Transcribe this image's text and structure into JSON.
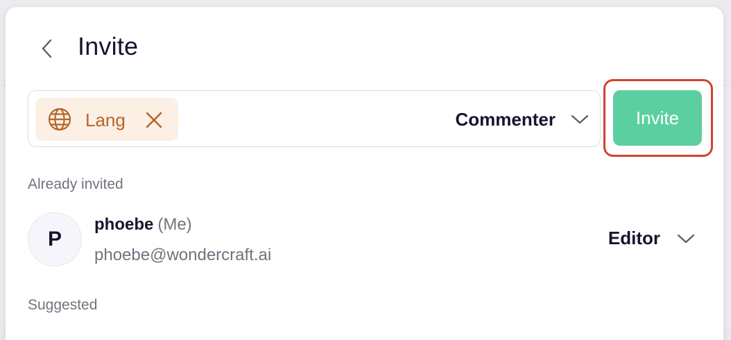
{
  "header": {
    "title": "Invite",
    "back_icon": "chevron-left-icon"
  },
  "invite": {
    "chip": {
      "label": "Lang",
      "icon": "globe-icon",
      "remove_icon": "close-icon"
    },
    "role": {
      "selected": "Commenter",
      "icon": "chevron-down-icon"
    },
    "button_label": "Invite"
  },
  "already_invited": {
    "heading": "Already invited",
    "members": [
      {
        "initial": "P",
        "name": "phoebe",
        "tag": "(Me)",
        "email": "phoebe@wondercraft.ai",
        "role": "Editor"
      }
    ]
  },
  "suggested": {
    "heading": "Suggested"
  },
  "colors": {
    "chip_bg": "#fcefe4",
    "chip_accent": "#b5652a",
    "invite_button": "#5ccfa0",
    "highlight_outline": "#d0432e",
    "text_primary": "#15152e",
    "text_muted": "#72727f"
  }
}
